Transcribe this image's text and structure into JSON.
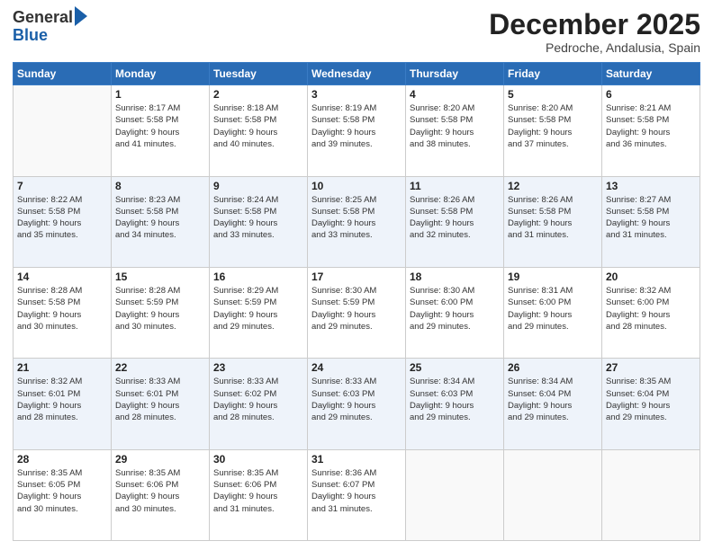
{
  "logo": {
    "general": "General",
    "blue": "Blue"
  },
  "header": {
    "month": "December 2025",
    "location": "Pedroche, Andalusia, Spain"
  },
  "weekdays": [
    "Sunday",
    "Monday",
    "Tuesday",
    "Wednesday",
    "Thursday",
    "Friday",
    "Saturday"
  ],
  "weeks": [
    [
      {
        "day": "",
        "info": ""
      },
      {
        "day": "1",
        "info": "Sunrise: 8:17 AM\nSunset: 5:58 PM\nDaylight: 9 hours\nand 41 minutes."
      },
      {
        "day": "2",
        "info": "Sunrise: 8:18 AM\nSunset: 5:58 PM\nDaylight: 9 hours\nand 40 minutes."
      },
      {
        "day": "3",
        "info": "Sunrise: 8:19 AM\nSunset: 5:58 PM\nDaylight: 9 hours\nand 39 minutes."
      },
      {
        "day": "4",
        "info": "Sunrise: 8:20 AM\nSunset: 5:58 PM\nDaylight: 9 hours\nand 38 minutes."
      },
      {
        "day": "5",
        "info": "Sunrise: 8:20 AM\nSunset: 5:58 PM\nDaylight: 9 hours\nand 37 minutes."
      },
      {
        "day": "6",
        "info": "Sunrise: 8:21 AM\nSunset: 5:58 PM\nDaylight: 9 hours\nand 36 minutes."
      }
    ],
    [
      {
        "day": "7",
        "info": "Sunrise: 8:22 AM\nSunset: 5:58 PM\nDaylight: 9 hours\nand 35 minutes."
      },
      {
        "day": "8",
        "info": "Sunrise: 8:23 AM\nSunset: 5:58 PM\nDaylight: 9 hours\nand 34 minutes."
      },
      {
        "day": "9",
        "info": "Sunrise: 8:24 AM\nSunset: 5:58 PM\nDaylight: 9 hours\nand 33 minutes."
      },
      {
        "day": "10",
        "info": "Sunrise: 8:25 AM\nSunset: 5:58 PM\nDaylight: 9 hours\nand 33 minutes."
      },
      {
        "day": "11",
        "info": "Sunrise: 8:26 AM\nSunset: 5:58 PM\nDaylight: 9 hours\nand 32 minutes."
      },
      {
        "day": "12",
        "info": "Sunrise: 8:26 AM\nSunset: 5:58 PM\nDaylight: 9 hours\nand 31 minutes."
      },
      {
        "day": "13",
        "info": "Sunrise: 8:27 AM\nSunset: 5:58 PM\nDaylight: 9 hours\nand 31 minutes."
      }
    ],
    [
      {
        "day": "14",
        "info": "Sunrise: 8:28 AM\nSunset: 5:58 PM\nDaylight: 9 hours\nand 30 minutes."
      },
      {
        "day": "15",
        "info": "Sunrise: 8:28 AM\nSunset: 5:59 PM\nDaylight: 9 hours\nand 30 minutes."
      },
      {
        "day": "16",
        "info": "Sunrise: 8:29 AM\nSunset: 5:59 PM\nDaylight: 9 hours\nand 29 minutes."
      },
      {
        "day": "17",
        "info": "Sunrise: 8:30 AM\nSunset: 5:59 PM\nDaylight: 9 hours\nand 29 minutes."
      },
      {
        "day": "18",
        "info": "Sunrise: 8:30 AM\nSunset: 6:00 PM\nDaylight: 9 hours\nand 29 minutes."
      },
      {
        "day": "19",
        "info": "Sunrise: 8:31 AM\nSunset: 6:00 PM\nDaylight: 9 hours\nand 29 minutes."
      },
      {
        "day": "20",
        "info": "Sunrise: 8:32 AM\nSunset: 6:00 PM\nDaylight: 9 hours\nand 28 minutes."
      }
    ],
    [
      {
        "day": "21",
        "info": "Sunrise: 8:32 AM\nSunset: 6:01 PM\nDaylight: 9 hours\nand 28 minutes."
      },
      {
        "day": "22",
        "info": "Sunrise: 8:33 AM\nSunset: 6:01 PM\nDaylight: 9 hours\nand 28 minutes."
      },
      {
        "day": "23",
        "info": "Sunrise: 8:33 AM\nSunset: 6:02 PM\nDaylight: 9 hours\nand 28 minutes."
      },
      {
        "day": "24",
        "info": "Sunrise: 8:33 AM\nSunset: 6:03 PM\nDaylight: 9 hours\nand 29 minutes."
      },
      {
        "day": "25",
        "info": "Sunrise: 8:34 AM\nSunset: 6:03 PM\nDaylight: 9 hours\nand 29 minutes."
      },
      {
        "day": "26",
        "info": "Sunrise: 8:34 AM\nSunset: 6:04 PM\nDaylight: 9 hours\nand 29 minutes."
      },
      {
        "day": "27",
        "info": "Sunrise: 8:35 AM\nSunset: 6:04 PM\nDaylight: 9 hours\nand 29 minutes."
      }
    ],
    [
      {
        "day": "28",
        "info": "Sunrise: 8:35 AM\nSunset: 6:05 PM\nDaylight: 9 hours\nand 30 minutes."
      },
      {
        "day": "29",
        "info": "Sunrise: 8:35 AM\nSunset: 6:06 PM\nDaylight: 9 hours\nand 30 minutes."
      },
      {
        "day": "30",
        "info": "Sunrise: 8:35 AM\nSunset: 6:06 PM\nDaylight: 9 hours\nand 31 minutes."
      },
      {
        "day": "31",
        "info": "Sunrise: 8:36 AM\nSunset: 6:07 PM\nDaylight: 9 hours\nand 31 minutes."
      },
      {
        "day": "",
        "info": ""
      },
      {
        "day": "",
        "info": ""
      },
      {
        "day": "",
        "info": ""
      }
    ]
  ]
}
